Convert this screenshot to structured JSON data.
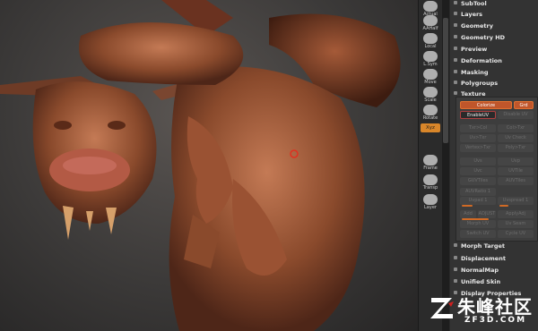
{
  "toolbar": {
    "buttons": [
      {
        "label": "Actual",
        "icon": "actual-size-icon"
      },
      {
        "label": "AAHalf",
        "icon": "aahalf-icon"
      },
      {
        "label": "Local",
        "icon": "local-icon"
      },
      {
        "label": "L.Sym",
        "icon": "local-symmetry-icon"
      },
      {
        "label": "Move",
        "icon": "move-icon"
      },
      {
        "label": "Scale",
        "icon": "scale-icon"
      },
      {
        "label": "Rotate",
        "icon": "rotate-icon"
      },
      {
        "label": "Frame",
        "icon": "frame-icon"
      },
      {
        "label": "Transp",
        "icon": "transparency-icon"
      },
      {
        "label": "Layer",
        "icon": "layer-icon"
      }
    ],
    "xyz_label": "Xyz"
  },
  "panel": {
    "menu_top": [
      "SubTool",
      "Layers",
      "Geometry",
      "Geometry HD",
      "Preview",
      "Deformation",
      "Masking",
      "Polygroups",
      "Texture"
    ],
    "menu_bottom": [
      "Morph Target",
      "Displacement",
      "NormalMap",
      "Unified Skin",
      "Display Properties"
    ]
  },
  "texture": {
    "colorize": "Colorize",
    "grd": "Grd",
    "enable_uv": "EnableUV",
    "disable_uv": "Disable UV",
    "rows": [
      [
        "Txr>Col",
        "Col>Txr"
      ],
      [
        "Uv>Txr",
        "Uv Check"
      ],
      [
        "Vertex>Txr",
        "Poly>Txr"
      ],
      [
        "Uvs",
        "Uvp"
      ],
      [
        "Uvc",
        "UVTile"
      ],
      [
        "GUVTiles",
        "AUVTiles"
      ]
    ],
    "auv_ratio": "AUVRatio 1",
    "uv_pad": "Uvpad 1",
    "uv_spread": "Uvspread 1",
    "row_adj": [
      "Add",
      "ADJUST",
      "ApplyAdj"
    ],
    "row_seam": [
      "Morph UV",
      "Uv Seam"
    ],
    "row_cycle": [
      "Switch UV",
      "Cycle UV"
    ]
  },
  "watermark": {
    "logo": "ZBrush logo",
    "text": "朱峰社区",
    "sub": "ZF3D.COM"
  }
}
